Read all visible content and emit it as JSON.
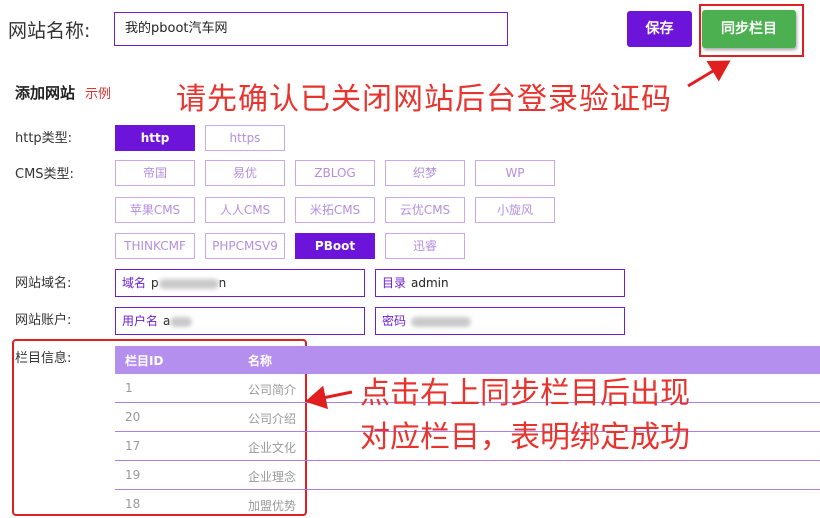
{
  "header": {
    "site_name_label": "网站名称:",
    "site_name_value": "我的pboot汽车网",
    "save_label": "保存",
    "sync_label": "同步栏目"
  },
  "add_section": {
    "title": "添加网站",
    "example": "示例"
  },
  "annotations": {
    "top_note": "请先确认已关闭网站后台登录验证码",
    "bottom_note_line1": "点击右上同步栏目后出现",
    "bottom_note_line2": "对应栏目，表明绑定成功",
    "color": "#e8342e"
  },
  "http_type": {
    "label": "http类型:",
    "options": [
      "http",
      "https"
    ],
    "selected": "http"
  },
  "cms_type": {
    "label": "CMS类型:",
    "rows": [
      [
        "帝国",
        "易优",
        "ZBLOG",
        "织梦",
        "WP"
      ],
      [
        "苹果CMS",
        "人人CMS",
        "米拓CMS",
        "云优CMS",
        "小旋风"
      ],
      [
        "THINKCMF",
        "PHPCMSV9",
        "PBoot",
        "迅睿"
      ]
    ],
    "selected": "PBoot"
  },
  "domain_row": {
    "label": "网站域名:",
    "domain_prefix": "域名",
    "domain_value_start": "p",
    "domain_value_end": "n",
    "dir_prefix": "目录",
    "dir_value": "admin"
  },
  "account_row": {
    "label": "网站账户:",
    "user_prefix": "用户名",
    "user_value_start": "a",
    "pass_prefix": "密码"
  },
  "categories": {
    "label": "栏目信息:",
    "columns": [
      "栏目ID",
      "名称"
    ],
    "rows": [
      {
        "id": "1",
        "name": "公司简介"
      },
      {
        "id": "20",
        "name": "公司介绍"
      },
      {
        "id": "17",
        "name": "企业文化"
      },
      {
        "id": "19",
        "name": "企业理念"
      },
      {
        "id": "18",
        "name": "加盟优势"
      }
    ]
  },
  "colors": {
    "primary": "#6c14d9",
    "sync_green": "#4caf50",
    "highlight_red": "#e02020",
    "header_purple": "#b48fee"
  }
}
